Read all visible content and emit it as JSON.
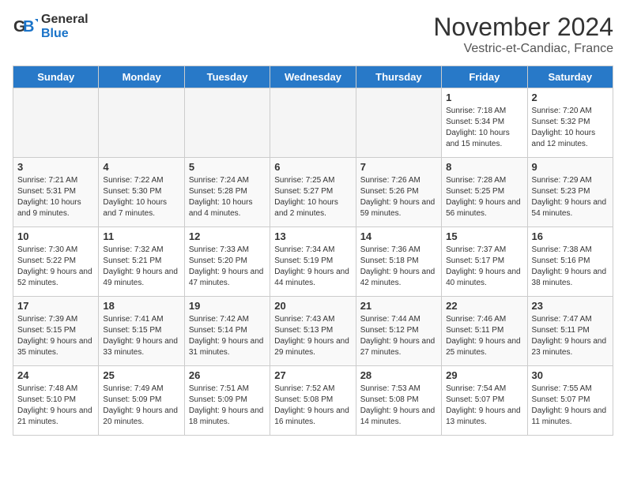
{
  "logo": {
    "general": "General",
    "blue": "Blue"
  },
  "title": "November 2024",
  "location": "Vestric-et-Candiac, France",
  "days_of_week": [
    "Sunday",
    "Monday",
    "Tuesday",
    "Wednesday",
    "Thursday",
    "Friday",
    "Saturday"
  ],
  "weeks": [
    [
      {
        "day": "",
        "info": ""
      },
      {
        "day": "",
        "info": ""
      },
      {
        "day": "",
        "info": ""
      },
      {
        "day": "",
        "info": ""
      },
      {
        "day": "",
        "info": ""
      },
      {
        "day": "1",
        "info": "Sunrise: 7:18 AM\nSunset: 5:34 PM\nDaylight: 10 hours and 15 minutes."
      },
      {
        "day": "2",
        "info": "Sunrise: 7:20 AM\nSunset: 5:32 PM\nDaylight: 10 hours and 12 minutes."
      }
    ],
    [
      {
        "day": "3",
        "info": "Sunrise: 7:21 AM\nSunset: 5:31 PM\nDaylight: 10 hours and 9 minutes."
      },
      {
        "day": "4",
        "info": "Sunrise: 7:22 AM\nSunset: 5:30 PM\nDaylight: 10 hours and 7 minutes."
      },
      {
        "day": "5",
        "info": "Sunrise: 7:24 AM\nSunset: 5:28 PM\nDaylight: 10 hours and 4 minutes."
      },
      {
        "day": "6",
        "info": "Sunrise: 7:25 AM\nSunset: 5:27 PM\nDaylight: 10 hours and 2 minutes."
      },
      {
        "day": "7",
        "info": "Sunrise: 7:26 AM\nSunset: 5:26 PM\nDaylight: 9 hours and 59 minutes."
      },
      {
        "day": "8",
        "info": "Sunrise: 7:28 AM\nSunset: 5:25 PM\nDaylight: 9 hours and 56 minutes."
      },
      {
        "day": "9",
        "info": "Sunrise: 7:29 AM\nSunset: 5:23 PM\nDaylight: 9 hours and 54 minutes."
      }
    ],
    [
      {
        "day": "10",
        "info": "Sunrise: 7:30 AM\nSunset: 5:22 PM\nDaylight: 9 hours and 52 minutes."
      },
      {
        "day": "11",
        "info": "Sunrise: 7:32 AM\nSunset: 5:21 PM\nDaylight: 9 hours and 49 minutes."
      },
      {
        "day": "12",
        "info": "Sunrise: 7:33 AM\nSunset: 5:20 PM\nDaylight: 9 hours and 47 minutes."
      },
      {
        "day": "13",
        "info": "Sunrise: 7:34 AM\nSunset: 5:19 PM\nDaylight: 9 hours and 44 minutes."
      },
      {
        "day": "14",
        "info": "Sunrise: 7:36 AM\nSunset: 5:18 PM\nDaylight: 9 hours and 42 minutes."
      },
      {
        "day": "15",
        "info": "Sunrise: 7:37 AM\nSunset: 5:17 PM\nDaylight: 9 hours and 40 minutes."
      },
      {
        "day": "16",
        "info": "Sunrise: 7:38 AM\nSunset: 5:16 PM\nDaylight: 9 hours and 38 minutes."
      }
    ],
    [
      {
        "day": "17",
        "info": "Sunrise: 7:39 AM\nSunset: 5:15 PM\nDaylight: 9 hours and 35 minutes."
      },
      {
        "day": "18",
        "info": "Sunrise: 7:41 AM\nSunset: 5:15 PM\nDaylight: 9 hours and 33 minutes."
      },
      {
        "day": "19",
        "info": "Sunrise: 7:42 AM\nSunset: 5:14 PM\nDaylight: 9 hours and 31 minutes."
      },
      {
        "day": "20",
        "info": "Sunrise: 7:43 AM\nSunset: 5:13 PM\nDaylight: 9 hours and 29 minutes."
      },
      {
        "day": "21",
        "info": "Sunrise: 7:44 AM\nSunset: 5:12 PM\nDaylight: 9 hours and 27 minutes."
      },
      {
        "day": "22",
        "info": "Sunrise: 7:46 AM\nSunset: 5:11 PM\nDaylight: 9 hours and 25 minutes."
      },
      {
        "day": "23",
        "info": "Sunrise: 7:47 AM\nSunset: 5:11 PM\nDaylight: 9 hours and 23 minutes."
      }
    ],
    [
      {
        "day": "24",
        "info": "Sunrise: 7:48 AM\nSunset: 5:10 PM\nDaylight: 9 hours and 21 minutes."
      },
      {
        "day": "25",
        "info": "Sunrise: 7:49 AM\nSunset: 5:09 PM\nDaylight: 9 hours and 20 minutes."
      },
      {
        "day": "26",
        "info": "Sunrise: 7:51 AM\nSunset: 5:09 PM\nDaylight: 9 hours and 18 minutes."
      },
      {
        "day": "27",
        "info": "Sunrise: 7:52 AM\nSunset: 5:08 PM\nDaylight: 9 hours and 16 minutes."
      },
      {
        "day": "28",
        "info": "Sunrise: 7:53 AM\nSunset: 5:08 PM\nDaylight: 9 hours and 14 minutes."
      },
      {
        "day": "29",
        "info": "Sunrise: 7:54 AM\nSunset: 5:07 PM\nDaylight: 9 hours and 13 minutes."
      },
      {
        "day": "30",
        "info": "Sunrise: 7:55 AM\nSunset: 5:07 PM\nDaylight: 9 hours and 11 minutes."
      }
    ]
  ]
}
